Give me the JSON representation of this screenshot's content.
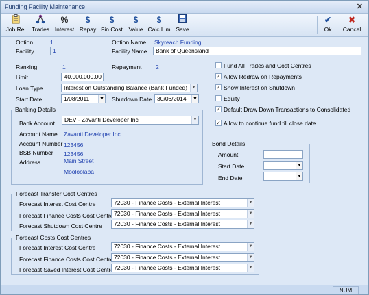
{
  "window": {
    "title": "Funding Facility Maintenance"
  },
  "toolbar": {
    "job_rel": "Job Rel",
    "trades": "Trades",
    "interest": "Interest",
    "repay": "Repay",
    "fin_cost": "Fin Cost",
    "value": "Value",
    "calc_lim": "Calc Lim",
    "save": "Save",
    "ok": "Ok",
    "cancel": "Cancel",
    "icons": {
      "interest_glyph": "%",
      "dollar_glyph": "$",
      "ok_glyph": "✔",
      "cancel_glyph": "✖"
    }
  },
  "header": {
    "option_label": "Option",
    "option_value": "1",
    "option_name_label": "Option Name",
    "option_name_value": "Skyreach Funding",
    "facility_label": "Facility",
    "facility_value": "1",
    "facility_name_label": "Facility Name",
    "facility_name_value": "Bank of Queensland"
  },
  "details": {
    "ranking_label": "Ranking",
    "ranking_value": "1",
    "repayment_label": "Repayment",
    "repayment_value": "2",
    "limit_label": "Limit",
    "limit_value": "40,000,000.00",
    "loan_type_label": "Loan Type",
    "loan_type_value": "Interest on Outstanding Balance (Bank Funded)",
    "start_date_label": "Start Date",
    "start_date_value": "1/08/2011",
    "shutdown_date_label": "Shutdown Date",
    "shutdown_date_value": "30/06/2014"
  },
  "options": [
    {
      "label": "Fund All Trades and Cost Centres",
      "checked": false
    },
    {
      "label": "Allow Redraw on Repayments",
      "checked": true
    },
    {
      "label": "Show Interest on Shutdown",
      "checked": true
    },
    {
      "label": "Equity",
      "checked": false
    },
    {
      "label": "Default Draw Down Transactions to Consolidated",
      "checked": true
    },
    {
      "label": "Allow to continue fund till close date",
      "checked": true
    }
  ],
  "banking": {
    "group_label": "Banking Details",
    "bank_account_label": "Bank Account",
    "bank_account_value": "DEV - Zavanti Developer Inc",
    "account_name_label": "Account Name",
    "account_name_value": "Zavanti Developer Inc",
    "account_number_label": "Account Number",
    "account_number_value": "123456",
    "bsb_label": "BSB Number",
    "bsb_value": "123456",
    "address_label": "Address",
    "address_line1": "Main Street",
    "address_line2": "Mooloolaba"
  },
  "bond": {
    "group_label": "Bond Details",
    "amount_label": "Amount",
    "amount_value": "",
    "start_date_label": "Start Date",
    "start_date_value": "",
    "end_date_label": "End Date",
    "end_date_value": ""
  },
  "forecast_transfer": {
    "group_label": "Forecast Transfer Cost Centres",
    "rows": [
      {
        "label": "Forecast Interest Cost Centre",
        "value": "72030 - Finance Costs - External Interest"
      },
      {
        "label": "Forecast Finance Costs Cost Centre",
        "value": "72030 - Finance Costs - External Interest"
      },
      {
        "label": "Forecast Shutdown Cost Centre",
        "value": "72030 - Finance Costs - External Interest"
      }
    ]
  },
  "forecast_costs": {
    "group_label": "Forecast Costs Cost Centres",
    "rows": [
      {
        "label": "Forecast Interest Cost Centre",
        "value": "72030 - Finance Costs - External Interest"
      },
      {
        "label": "Forecast Finance Costs Cost Centre",
        "value": "72030 - Finance Costs - External Interest"
      },
      {
        "label": "Forecast Saved Interest Cost Centre",
        "value": "72030 - Finance Costs - External Interest"
      }
    ]
  },
  "status": {
    "num": "NUM"
  },
  "colors": {
    "accent": "#2243b0",
    "window_bg": "#dde8f6"
  }
}
